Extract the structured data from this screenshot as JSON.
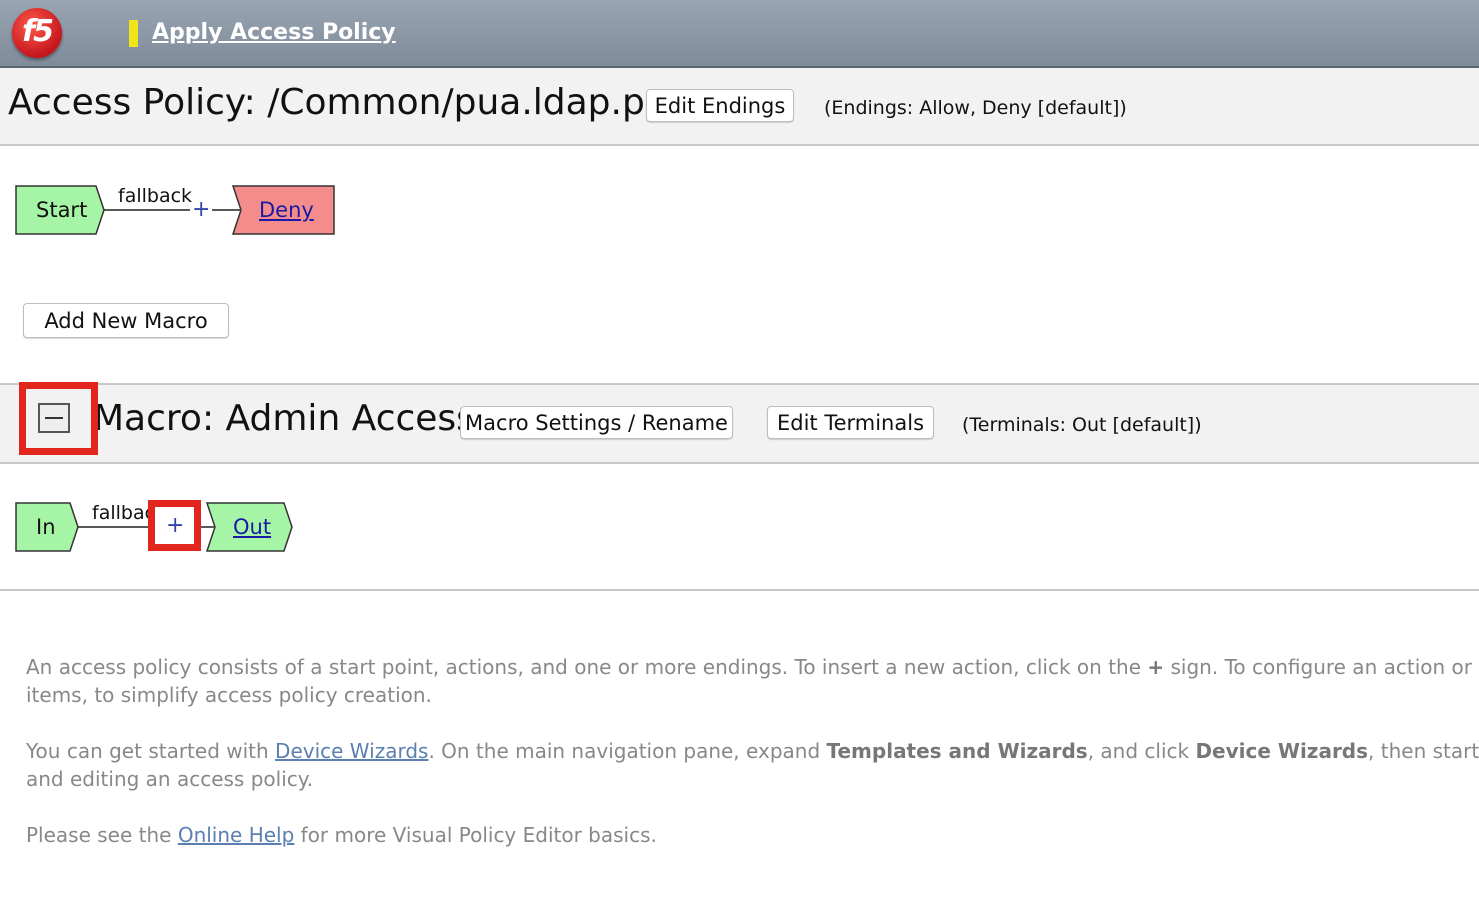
{
  "header": {
    "logo_text": "f5",
    "app_title": "Apply Access Policy"
  },
  "policy": {
    "title": "Access Policy: /Common/pua.ldap.psp",
    "edit_endings_label": "Edit Endings",
    "endings_info": "(Endings: Allow, Deny [default])",
    "flow": {
      "start_label": "Start",
      "branch_label": "fallback",
      "plus": "+",
      "end_label": "Deny"
    },
    "add_macro_label": "Add New Macro"
  },
  "macro": {
    "title": "Macro: Admin Access",
    "settings_label": "Macro Settings / Rename",
    "edit_terminals_label": "Edit Terminals",
    "terminals_info": "(Terminals: Out [default])",
    "flow": {
      "in_label": "In",
      "branch_label": "fallback",
      "plus": "+",
      "out_label": "Out"
    }
  },
  "help": {
    "p1_line1_a": "An access policy consists of a start point, actions, and one or more endings. To insert a new action, click on the ",
    "p1_plus": "+",
    "p1_line1_b": " sign. To configure an action or end",
    "p1_line2": "items, to simplify access policy creation.",
    "p2_a": "You can get started with ",
    "p2_link": "Device Wizards",
    "p2_b": ". On the main navigation pane, expand ",
    "p2_bold1": "Templates and Wizards",
    "p2_c": ", and click ",
    "p2_bold2": "Device Wizards",
    "p2_d": ", then start an",
    "p2_line2": "and editing an access policy.",
    "p3_a": "Please see the ",
    "p3_link": "Online Help",
    "p3_b": " for more Visual Policy Editor basics."
  },
  "colors": {
    "start_node": "#a6f5a6",
    "deny_node": "#f58c8c",
    "highlight": "#e2261d"
  }
}
